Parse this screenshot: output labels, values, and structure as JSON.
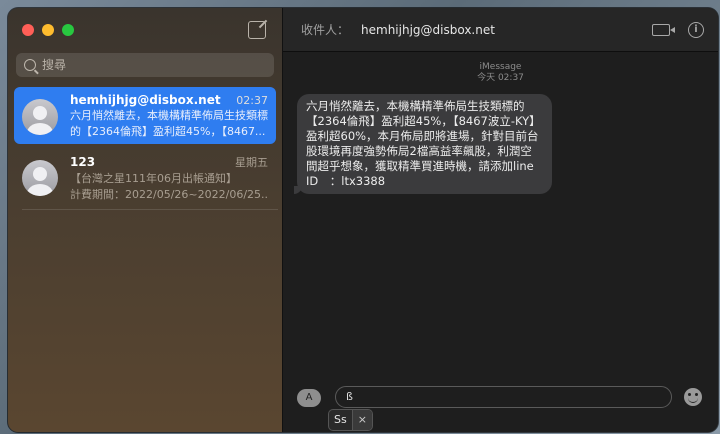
{
  "sidebar": {
    "search_placeholder": "搜尋",
    "conversations": [
      {
        "name": "hemhijhjg@disbox.net",
        "time": "02:37",
        "preview_line1": "六月悄然離去，本機構精準佈局生技類標",
        "preview_line2": "的【2364倫飛】盈利超45%，【8467...",
        "selected": true
      },
      {
        "name": "123",
        "time": "星期五",
        "preview_line1": "【台灣之星111年06月出帳通知】",
        "preview_line2": "計費期間：2022/05/26~2022/06/25...",
        "selected": false
      }
    ]
  },
  "header": {
    "to_label": "收件人：",
    "to_value": "hemhijhjg@disbox.net"
  },
  "thread": {
    "service": "iMessage",
    "timestamp": "今天 02:37",
    "message": "六月悄然離去，本機構精準佈局生技類標的【2364倫飛】盈利超45%，【8467波立-KY】盈利超60%，本月佈局即將進場，針對目前台股環境再度強勢佈局2檔高益率飆股，利潤空間超乎想象，獲取精準買進時機，請添加line ID　：ltx3388"
  },
  "composer": {
    "apps_label": "A",
    "input_value": "ß"
  },
  "ime": {
    "candidate": "Ss",
    "close": "×"
  },
  "colors": {
    "selected_blue": "#2f7df0",
    "bubble_gray": "#3b3b3d"
  }
}
